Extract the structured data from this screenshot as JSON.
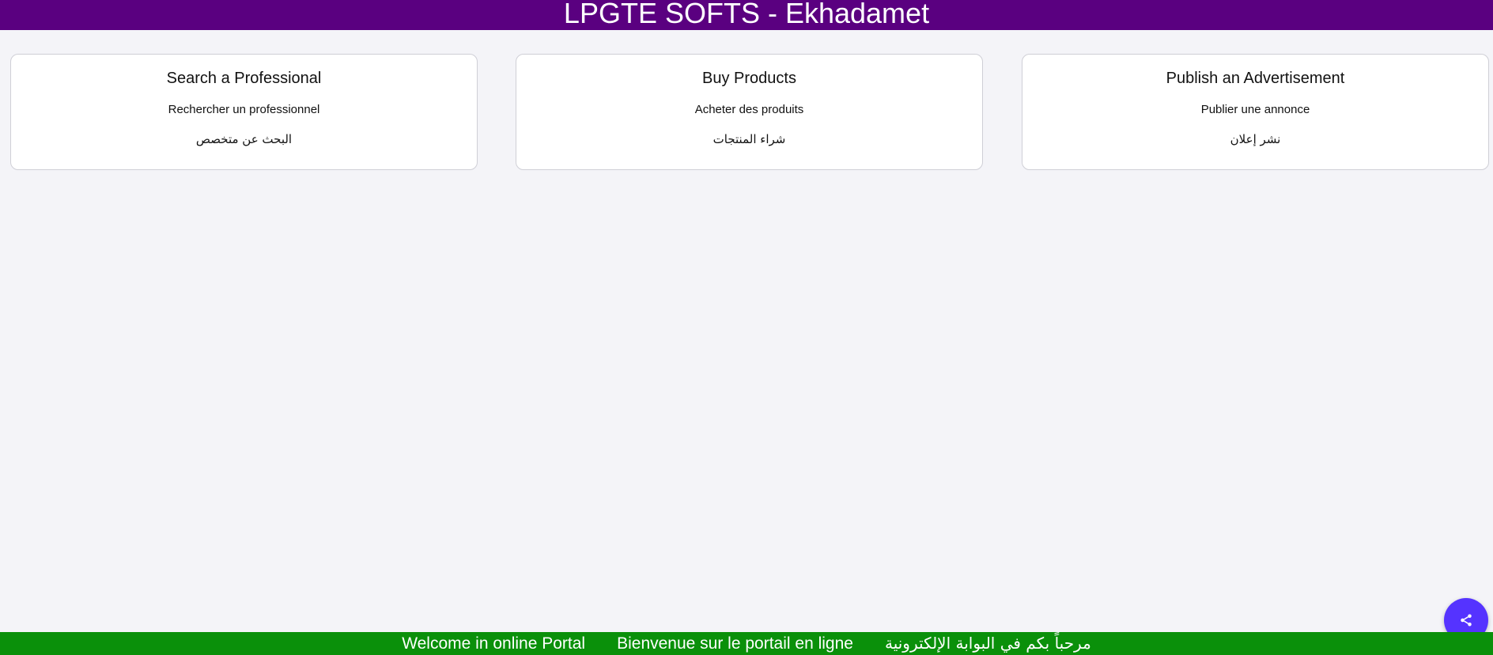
{
  "header": {
    "title": "LPGTE SOFTS - Ekhadamet",
    "background": "#5a0080"
  },
  "cards": [
    {
      "title": "Search a Professional",
      "fr": "Rechercher un professionnel",
      "ar": "البحث عن متخصص"
    },
    {
      "title": "Buy Products",
      "fr": "Acheter des produits",
      "ar": "شراء المنتجات"
    },
    {
      "title": "Publish an Advertisement",
      "fr": "Publier une annonce",
      "ar": "نشر إعلان"
    }
  ],
  "footer": {
    "en": "Welcome in online Portal",
    "fr": "Bienvenue sur le portail en ligne",
    "ar": "مرحباً بكم في البوابة الإلكترونية",
    "background": "#0a900a"
  },
  "fab": {
    "icon": "share-icon",
    "color": "#5533ff"
  }
}
